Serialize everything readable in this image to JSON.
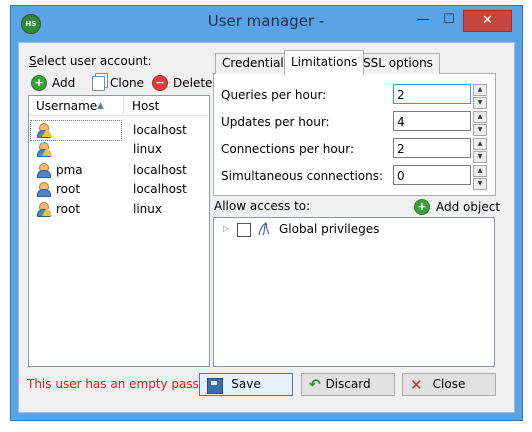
{
  "window": {
    "title": "User manager -",
    "controls": {
      "minimize": "—",
      "maximize": "☐",
      "close": "✕"
    }
  },
  "app_icon": "HS",
  "left_pane": {
    "select_label_prefix": "S",
    "select_label_rest": "elect user account:",
    "toolbar": {
      "add": "Add",
      "clone": "Clone",
      "delete": "Delete"
    },
    "columns": {
      "username": "Username",
      "host": "Host"
    },
    "sort_indicator": "▲",
    "users": [
      {
        "username": "",
        "host": "localhost",
        "warning": true
      },
      {
        "username": "",
        "host": "linux",
        "warning": true
      },
      {
        "username": "pma",
        "host": "localhost",
        "warning": false
      },
      {
        "username": "root",
        "host": "localhost",
        "warning": false
      },
      {
        "username": "root",
        "host": "linux",
        "warning": true
      }
    ]
  },
  "tabs": {
    "credentials": "Credentials",
    "limitations": "Limitations",
    "ssl": "SSL options",
    "active": "Limitations"
  },
  "limits": {
    "queries_label": "Queries per hour:",
    "queries_value": "2",
    "updates_label": "Updates per hour:",
    "updates_value": "4",
    "connections_label": "Connections per hour:",
    "connections_value": "2",
    "simultaneous_label": "Simultaneous connections:",
    "simultaneous_value": "0"
  },
  "access": {
    "label": "Allow access to:",
    "add_object": "Add object",
    "tree_expander": "▷",
    "tree_item": "Global privileges"
  },
  "footer": {
    "status": "This user has an empty password.",
    "save": "Save",
    "discard": "Discard",
    "close": "Close"
  }
}
